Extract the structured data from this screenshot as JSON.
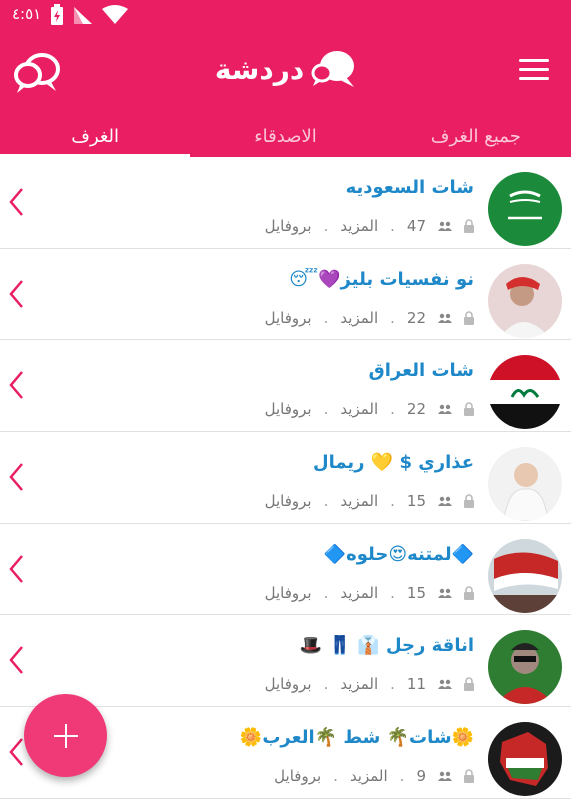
{
  "status": {
    "time": "٤:٥١"
  },
  "appbar": {
    "title": "دردشة"
  },
  "tabs": [
    {
      "label": "جميع الغرف"
    },
    {
      "label": "الاصدقاء"
    },
    {
      "label": "الغرف"
    }
  ],
  "rooms": [
    {
      "name": "شات السعوديه",
      "users": "47",
      "more": "المزيد",
      "profile": "بروفايل",
      "dot": "."
    },
    {
      "name": "نو نفسيات بليز💜😴",
      "users": "22",
      "more": "المزيد",
      "profile": "بروفايل",
      "dot": "."
    },
    {
      "name": "شات العراق",
      "users": "22",
      "more": "المزيد",
      "profile": "بروفايل",
      "dot": "."
    },
    {
      "name": "عذاري $ 💛 ريمال",
      "users": "15",
      "more": "المزيد",
      "profile": "بروفايل",
      "dot": "."
    },
    {
      "name": "🔷لمتنه😍حلوه🔷",
      "users": "15",
      "more": "المزيد",
      "profile": "بروفايل",
      "dot": "."
    },
    {
      "name": "اناقة رجل 👔 👖 🎩",
      "users": "11",
      "more": "المزيد",
      "profile": "بروفايل",
      "dot": "."
    },
    {
      "name": "🌼شات🌴 شط 🌴العرب🌼",
      "users": "9",
      "more": "المزيد",
      "profile": "بروفايل",
      "dot": "."
    }
  ],
  "colors": {
    "primary": "#e91e63",
    "fab": "#f03a78",
    "link": "#1e88c8"
  }
}
